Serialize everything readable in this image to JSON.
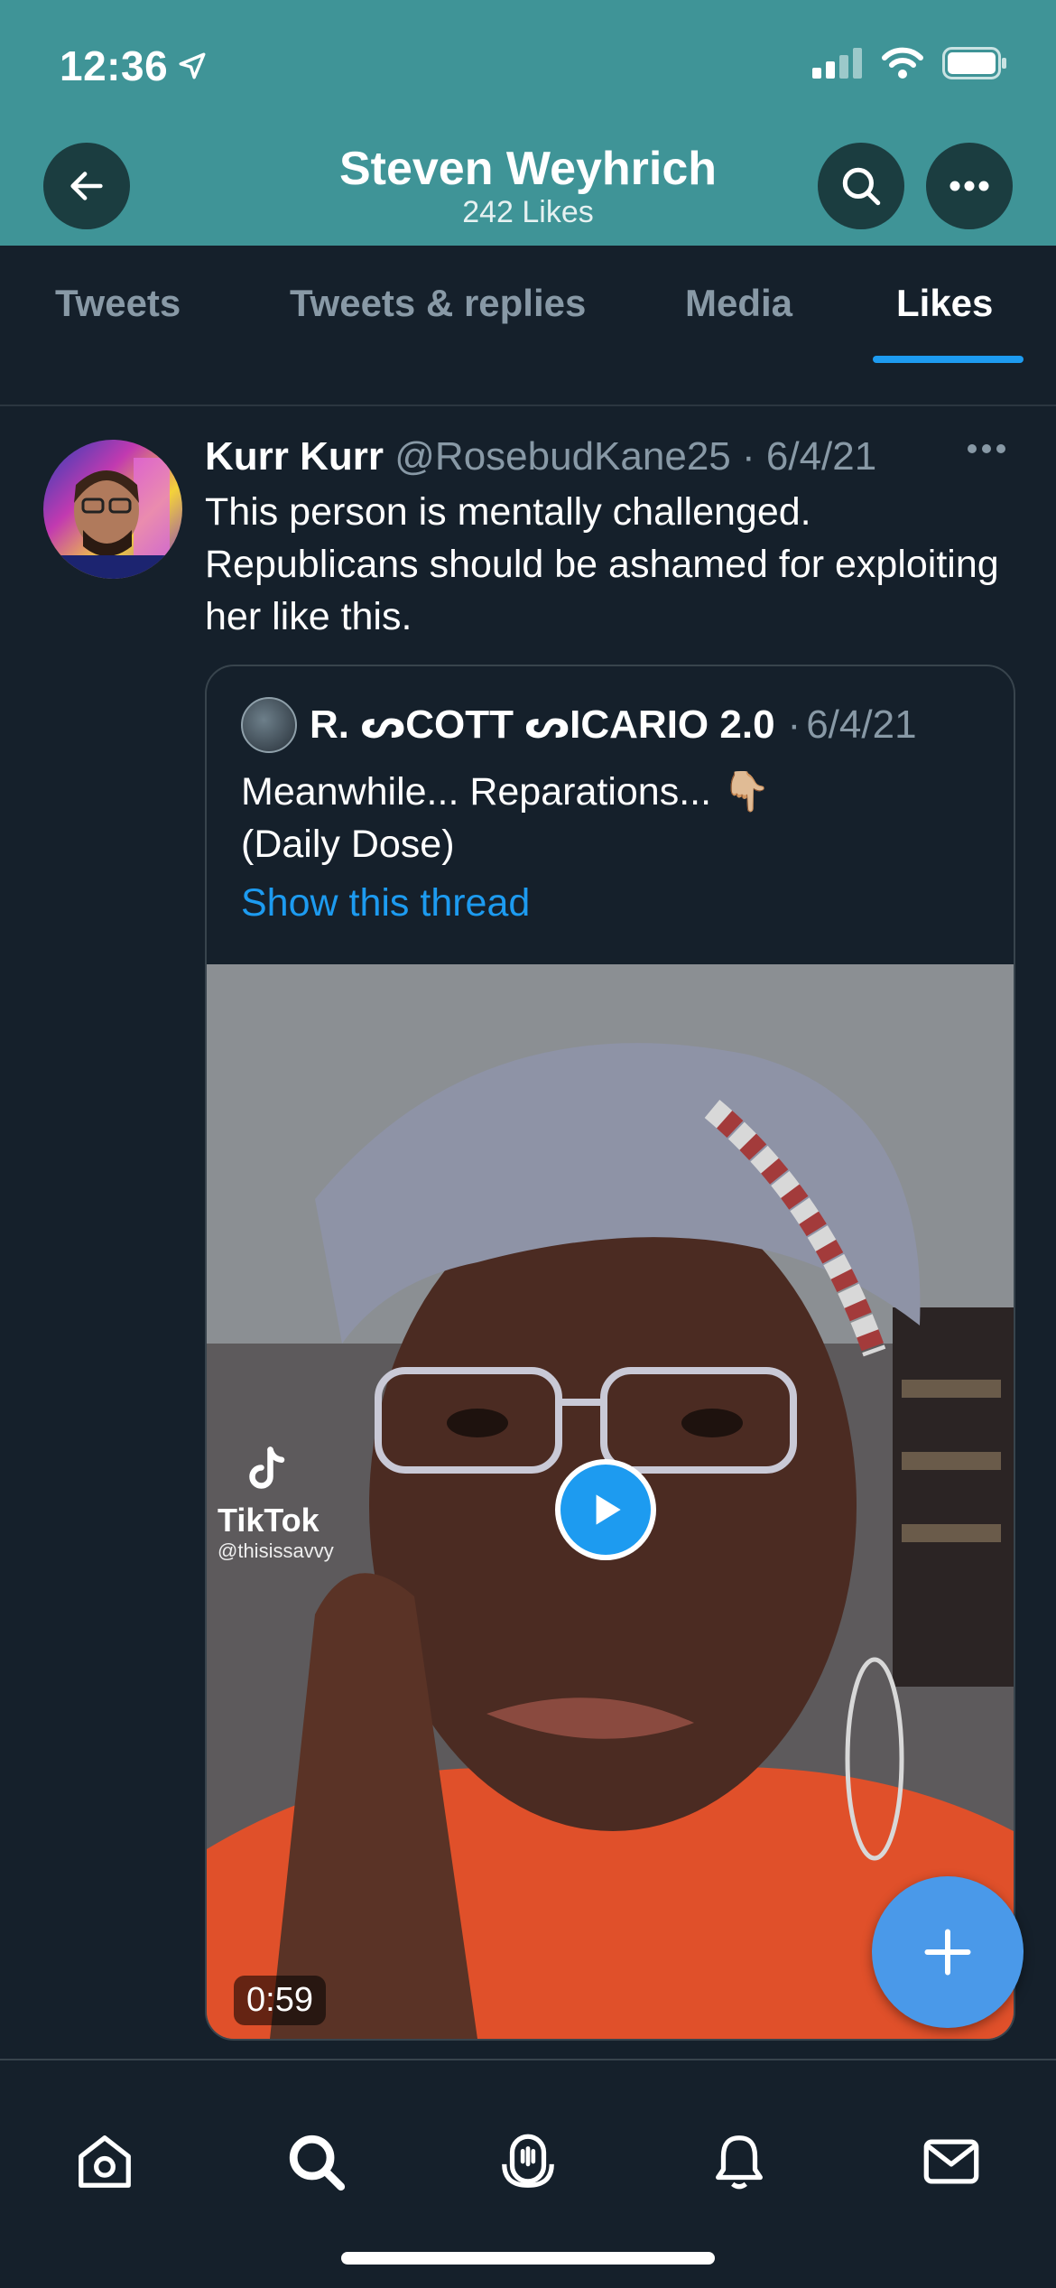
{
  "status_bar": {
    "time": "12:36"
  },
  "header": {
    "name": "Steven Weyhrich",
    "subtitle": "242 Likes"
  },
  "tabs": [
    {
      "label": "Tweets",
      "active": false
    },
    {
      "label": "Tweets & replies",
      "active": false
    },
    {
      "label": "Media",
      "active": false
    },
    {
      "label": "Likes",
      "active": true
    }
  ],
  "tweet": {
    "author_name": "Kurr Kurr",
    "handle": "@RosebudKane25",
    "date": "6/4/21",
    "text": "This person is mentally challenged. Republicans should be ashamed for exploiting her like this."
  },
  "quoted_tweet": {
    "author_name": "R. ᔕCOTT ᔕICARIO 2.0",
    "date": "6/4/21",
    "text_line1": "Meanwhile... Reparations... 👇🏼",
    "text_line2": "(Daily Dose)",
    "show_thread": "Show this thread",
    "video_duration": "0:59",
    "watermark_name": "TikTok",
    "watermark_handle": "@thisissavvy"
  },
  "colors": {
    "header_bg": "#3f9497",
    "page_bg": "#15202b",
    "accent": "#1d9bf0",
    "muted": "#8899a6"
  },
  "icons": {
    "back": "arrow-left-icon",
    "search": "search-icon",
    "more": "more-horizontal-icon",
    "nav": [
      "home-icon",
      "search-icon",
      "spaces-icon",
      "notifications-icon",
      "messages-icon"
    ]
  }
}
